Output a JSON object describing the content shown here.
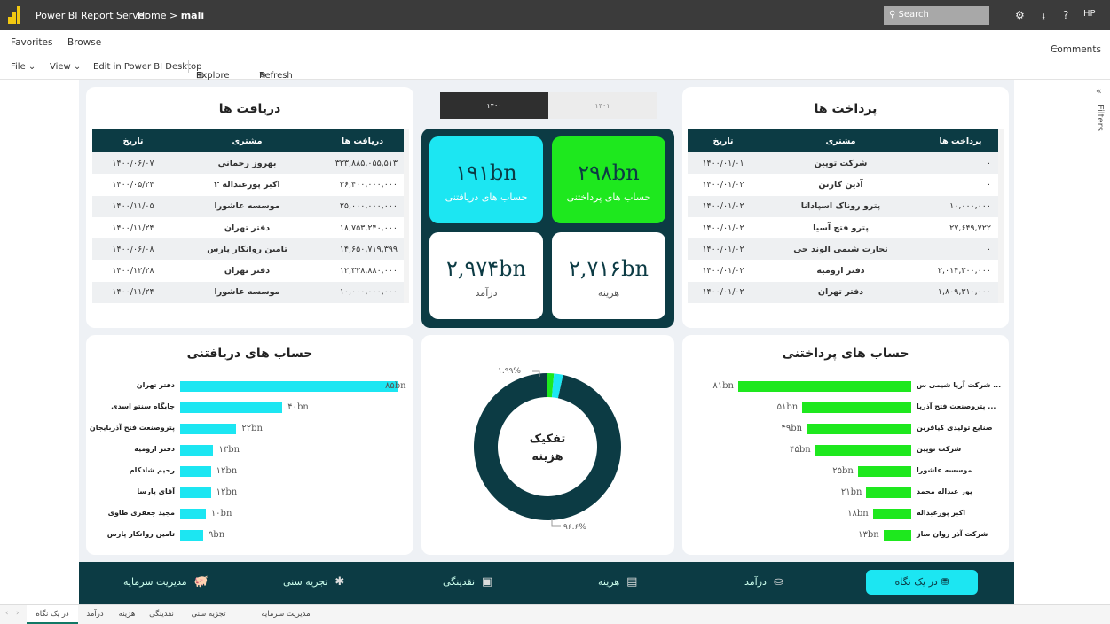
{
  "header": {
    "app_title": "Power BI Report Server",
    "crumb_home": "Home",
    "crumb_sep": ">",
    "crumb_page": "mali",
    "search_placeholder": "Search",
    "user": "HP"
  },
  "menu": {
    "favorites": "Favorites",
    "browse": "Browse",
    "comments": "Comments"
  },
  "toolbar": {
    "file": "File ⌄",
    "view": "View ⌄",
    "edit": "Edit in Power BI Desktop",
    "explore": "Explore ⌄",
    "refresh": "Refresh"
  },
  "filters_label": "Filters",
  "years": {
    "y1": "۱۴۰۰",
    "y2": "۱۴۰۱"
  },
  "received": {
    "title": "دریافت ها",
    "columns": [
      "تاریخ",
      "مشتری",
      "دریافت ها"
    ],
    "rows": [
      [
        "۱۴۰۰/۰۶/۰۷",
        "بهروز رحمانی",
        "۳۳۳,۸۸۵,۰۵۵,۵۱۳"
      ],
      [
        "۱۴۰۰/۰۵/۲۴",
        "اکبر پورعبداله ۲",
        "۲۶,۴۰۰,۰۰۰,۰۰۰"
      ],
      [
        "۱۴۰۰/۱۱/۰۵",
        "موسسه عاشورا",
        "۲۵,۰۰۰,۰۰۰,۰۰۰"
      ],
      [
        "۱۴۰۰/۱۱/۲۴",
        "دفتر تهران",
        "۱۸,۷۵۳,۲۴۰,۰۰۰"
      ],
      [
        "۱۴۰۰/۰۶/۰۸",
        "تامین روانکار پارس",
        "۱۴,۶۵۰,۷۱۹,۳۹۹"
      ],
      [
        "۱۴۰۰/۱۲/۲۸",
        "دفتر تهران",
        "۱۲,۳۲۸,۸۸۰,۰۰۰"
      ],
      [
        "۱۴۰۰/۱۱/۲۴",
        "موسسه عاشورا",
        "۱۰,۰۰۰,۰۰۰,۰۰۰"
      ]
    ]
  },
  "paid": {
    "title": "پرداخت ها",
    "columns": [
      "تاریخ",
      "مشتری",
      "پرداخت ها"
    ],
    "rows": [
      [
        "۱۴۰۰/۰۱/۰۱",
        "شرکت توپین",
        "۰"
      ],
      [
        "۱۴۰۰/۰۱/۰۲",
        "آذین کارتن",
        "۰"
      ],
      [
        "۱۴۰۰/۰۱/۰۲",
        "پترو روناک اسپادانا",
        "۱۰,۰۰۰,۰۰۰"
      ],
      [
        "۱۴۰۰/۰۱/۰۲",
        "پترو فتح آسیا",
        "۲۷,۶۴۹,۷۲۲"
      ],
      [
        "۱۴۰۰/۰۱/۰۲",
        "تجارت شیمی الوند جی",
        "۰"
      ],
      [
        "۱۴۰۰/۰۱/۰۲",
        "دفتر ارومیه",
        "۲,۰۱۴,۳۰۰,۰۰۰"
      ],
      [
        "۱۴۰۰/۰۱/۰۲",
        "دفتر تهران",
        "۱,۸۰۹,۳۱۰,۰۰۰"
      ]
    ]
  },
  "kpis": {
    "receivable": {
      "value": "۱۹۱bn",
      "label": "حساب های دریافتنی",
      "color": "#1ce6f2"
    },
    "payable": {
      "value": "۲۹۸bn",
      "label": "حساب های پرداختنی",
      "color": "#1ee81e"
    },
    "income": {
      "value": "۲,۹۷۴bn",
      "label": "درآمد"
    },
    "expense": {
      "value": "۲,۷۱۶bn",
      "label": "هزینه"
    }
  },
  "receivable_chart": {
    "title": "حساب های دریافتنی",
    "color": "#1ce6f2",
    "items": [
      {
        "label": "دفتر تهران",
        "value": 85,
        "text": "۸۵bn"
      },
      {
        "label": "جایگاه سنتو اسدی",
        "value": 40,
        "text": "۴۰bn"
      },
      {
        "label": "پتروصنعت فتح آذربایجان",
        "value": 22,
        "text": "۲۲bn"
      },
      {
        "label": "دفتر ارومیه",
        "value": 13,
        "text": "۱۳bn"
      },
      {
        "label": "رحیم شادکام",
        "value": 12,
        "text": "۱۲bn"
      },
      {
        "label": "آقای پارسا",
        "value": 12,
        "text": "۱۲bn"
      },
      {
        "label": "مجید جعفری طاوی",
        "value": 10,
        "text": "۱۰bn"
      },
      {
        "label": "تامین روانکار پارس",
        "value": 9,
        "text": "۹bn"
      }
    ]
  },
  "payable_chart": {
    "title": "حساب های پرداختنی",
    "color": "#1ee81e",
    "items": [
      {
        "label": "شرکت آریا شیمی س ...",
        "value": 81,
        "text": "۸۱bn"
      },
      {
        "label": "پتروصنعت فتح آذربا ...",
        "value": 51,
        "text": "۵۱bn"
      },
      {
        "label": "صنایع تولیدی کیافرین",
        "value": 49,
        "text": "۴۹bn"
      },
      {
        "label": "شرکت توپین",
        "value": 45,
        "text": "۴۵bn"
      },
      {
        "label": "موسسه عاشورا",
        "value": 25,
        "text": "۲۵bn"
      },
      {
        "label": "پور عبداله محمد",
        "value": 21,
        "text": "۲۱bn"
      },
      {
        "label": "اکبر پورعبداله",
        "value": 18,
        "text": "۱۸bn"
      },
      {
        "label": "شرکت آذر روان ساز",
        "value": 13,
        "text": "۱۳bn"
      }
    ]
  },
  "donut": {
    "center_line1": "تفکیک",
    "center_line2": "هزینه",
    "slices": [
      {
        "value": 96.6,
        "label": "۹۶.۶%",
        "color": "#0c3b44"
      },
      {
        "value": 1.99,
        "label": "۱.۹۹%",
        "color": "#1ce6f2"
      },
      {
        "value": 1.41,
        "label": "",
        "color": "#1ee81e"
      }
    ]
  },
  "chart_data": [
    {
      "type": "bar",
      "title": "حساب های دریافتنی",
      "categories": [
        "دفتر تهران",
        "جایگاه سنتو اسدی",
        "پتروصنعت فتح آذربایجان",
        "دفتر ارومیه",
        "رحیم شادکام",
        "آقای پارسا",
        "مجید جعفری طاوی",
        "تامین روانکار پارس"
      ],
      "values": [
        85,
        40,
        22,
        13,
        12,
        12,
        10,
        9
      ]
    },
    {
      "type": "bar",
      "title": "حساب های پرداختنی",
      "categories": [
        "شرکت آریا شیمی س ...",
        "پتروصنعت فتح آذربا ...",
        "صنایع تولیدی کیافرین",
        "شرکت توپین",
        "موسسه عاشورا",
        "پور عبداله محمد",
        "اکبر پورعبداله",
        "شرکت آذر روان ساز"
      ],
      "values": [
        81,
        51,
        49,
        45,
        25,
        21,
        18,
        13
      ]
    },
    {
      "type": "pie",
      "title": "تفکیک هزینه",
      "categories": [
        "",
        "",
        ""
      ],
      "values": [
        96.6,
        1.99,
        1.41
      ]
    }
  ],
  "nav": {
    "glance": "در یک نگاه",
    "income": "درآمد",
    "expense": "هزینه",
    "liquidity": "نقدینگی",
    "aging": "تجزیه سنی",
    "capital": "مدیریت سرمایه"
  },
  "page_tabs": [
    "در یک نگاه",
    "درآمد",
    "هزینه",
    "نقدینگی",
    "تجزیه سنی",
    "مدیریت سرمایه"
  ]
}
